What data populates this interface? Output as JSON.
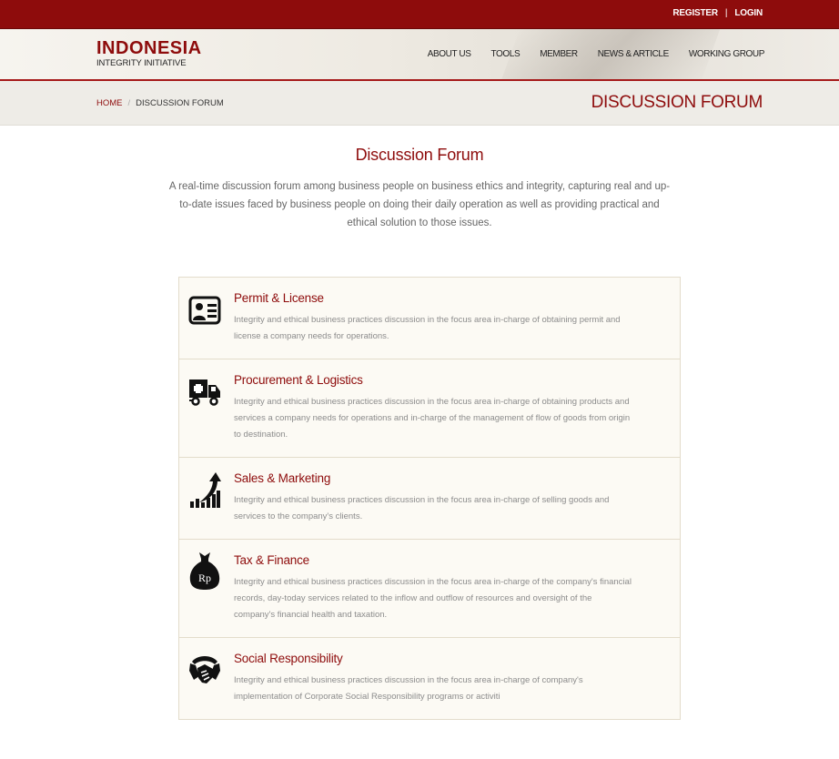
{
  "topbar": {
    "register": "REGISTER",
    "separator": "|",
    "login": "LOGIN"
  },
  "logo": {
    "line1": "INDONESIA",
    "line2": "INTEGRITY INITIATIVE"
  },
  "nav": [
    {
      "label": "ABOUT US"
    },
    {
      "label": "TOOLS"
    },
    {
      "label": "MEMBER"
    },
    {
      "label": "NEWS & ARTICLE"
    },
    {
      "label": "WORKING GROUP"
    }
  ],
  "breadcrumb": {
    "home": "HOME",
    "separator": "/",
    "current": "DISCUSSION FORUM"
  },
  "page_heading": "DISCUSSION FORUM",
  "section": {
    "title": "Discussion Forum",
    "intro": "A real-time discussion forum among business people on business ethics and integrity, capturing real and up-to-date issues faced by business people on doing their daily operation as well as providing practical and ethical solution to those issues."
  },
  "forums": [
    {
      "icon": "id-card-icon",
      "title": "Permit & License",
      "description": "Integrity and ethical business practices discussion in the focus area in-charge of obtaining permit and license a company needs for operations."
    },
    {
      "icon": "delivery-truck-icon",
      "title": "Procurement & Logistics",
      "description": "Integrity and ethical business practices discussion in the focus area in-charge of obtaining products and services a company needs for operations and in-charge of the management of flow of goods from origin to destination."
    },
    {
      "icon": "growth-chart-icon",
      "title": "Sales & Marketing",
      "description": "Integrity and ethical business practices discussion in the focus area in-charge of selling goods and services to the company's clients."
    },
    {
      "icon": "money-bag-icon",
      "icon_text": "Rp",
      "title": "Tax & Finance",
      "description": "Integrity and ethical business practices discussion in the focus area in-charge of the company's financial records, day-today services related to the inflow and outflow of resources and oversight of the company's financial health and taxation."
    },
    {
      "icon": "handshake-icon",
      "title": "Social Responsibility",
      "description": "Integrity and ethical business practices discussion in the focus area in-charge of company's implementation of Corporate Social Responsibility programs or activiti"
    }
  ],
  "colors": {
    "brand": "#8e0c0c",
    "panel": "#fcfaf4",
    "border": "#e3dccb",
    "muted_text": "#8c8c8c"
  }
}
